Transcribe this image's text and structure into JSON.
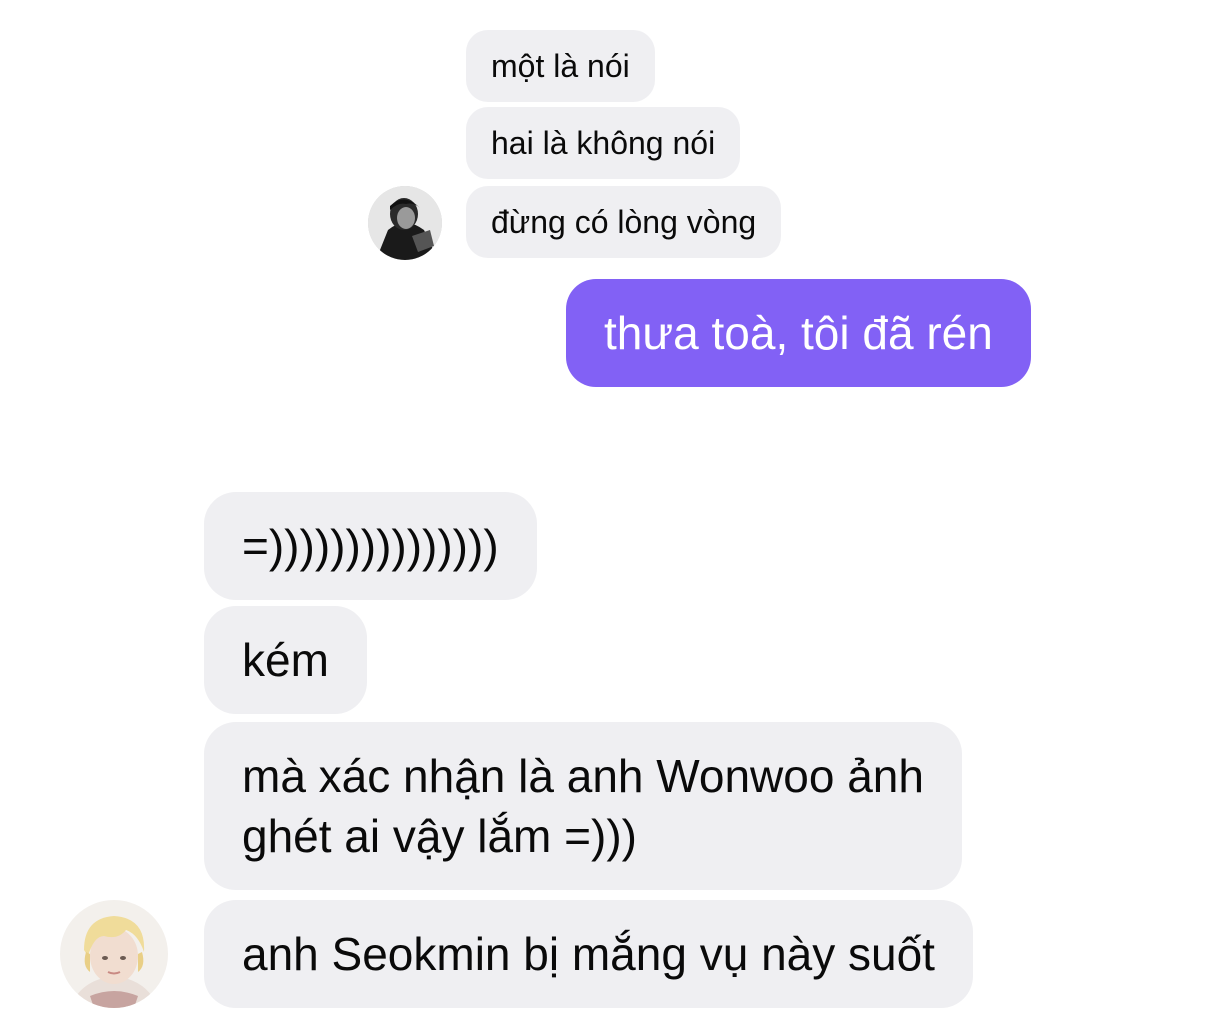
{
  "messages": {
    "m1": "một là nói",
    "m2": "hai là không nói",
    "m3": "đừng có lòng vòng",
    "m4": "thưa toà, tôi đã rén",
    "m5": "=)))))))))))))))",
    "m6": "kém",
    "m7_line1": "mà xác nhận là anh Wonwoo ảnh",
    "m7_line2": "ghét ai vậy lắm =)))",
    "m8": "anh Seokmin bị mắng vụ này suốt"
  },
  "colors": {
    "incoming_bubble": "#efeff2",
    "outgoing_bubble": "#8261f5",
    "outgoing_text": "#ffffff",
    "incoming_text": "#0a0a0a"
  }
}
